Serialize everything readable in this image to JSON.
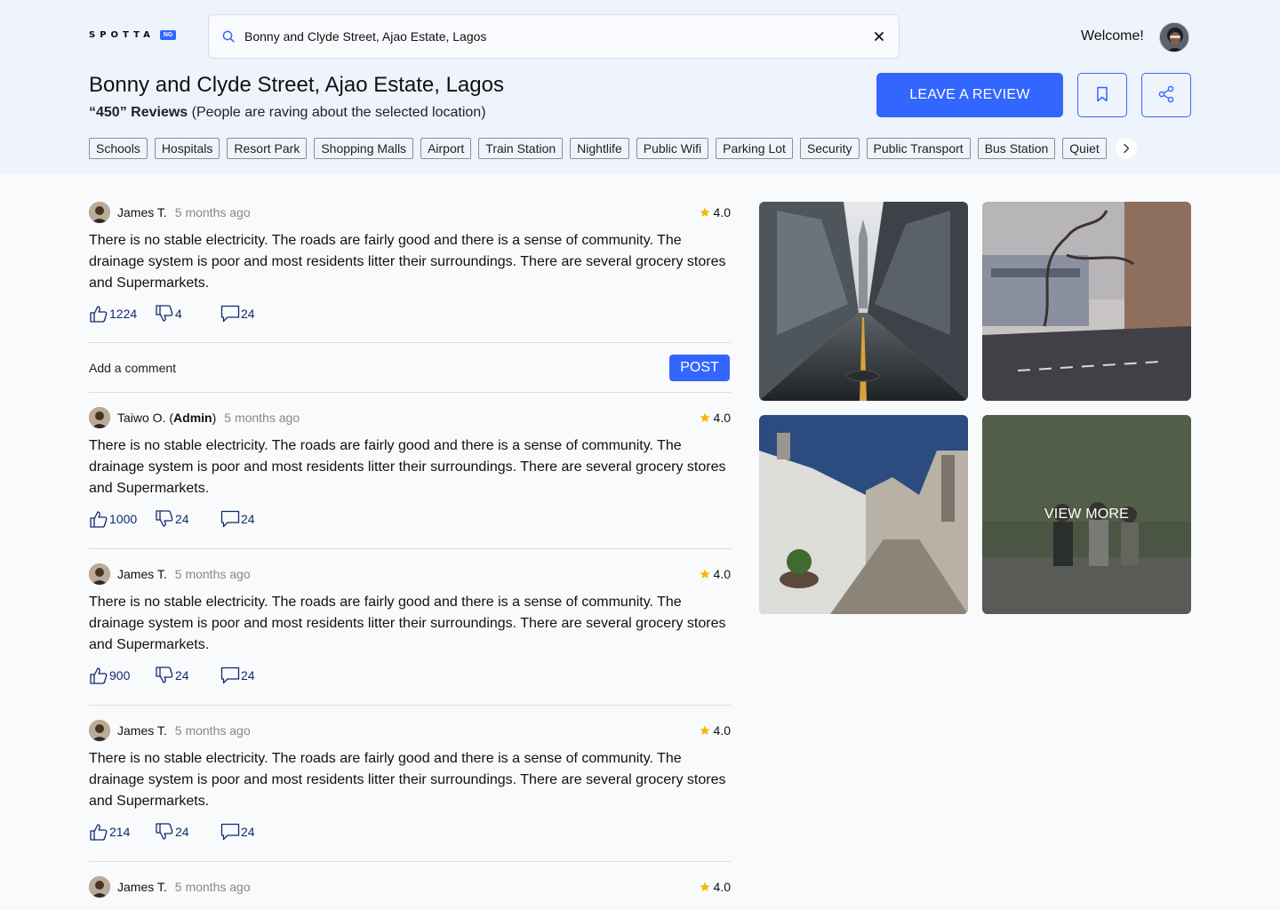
{
  "brand": {
    "name": "SPOTTA",
    "badge": "NG"
  },
  "search": {
    "value": "Bonny and Clyde Street, Ajao Estate, Lagos"
  },
  "user": {
    "welcome": "Welcome!"
  },
  "location": {
    "title": "Bonny and Clyde Street, Ajao Estate, Lagos",
    "review_count": "“450” Reviews",
    "review_note": "(People are raving about the selected location)"
  },
  "actions": {
    "leave_review": "LEAVE A REVIEW"
  },
  "tags": [
    "Schools",
    "Hospitals",
    "Resort Park",
    "Shopping Malls",
    "Airport",
    "Train Station",
    "Nightlife",
    "Public Wifi",
    "Parking Lot",
    "Security",
    "Public Transport",
    "Bus Station",
    "Quiet"
  ],
  "reviews": [
    {
      "name": "James T.",
      "role": "",
      "time": "5 months ago",
      "rating": "4.0",
      "text": "There is no stable electricity. The roads are fairly good and there is a sense of community. The drainage system is poor and most residents litter their surroundings. There are several grocery stores and Supermarkets.",
      "likes": "1224",
      "dislikes": "4",
      "comments": "24"
    },
    {
      "name": "Taiwo O.",
      "role": "Admin",
      "time": "5 months ago",
      "rating": "4.0",
      "text": "There is no stable electricity. The roads are fairly good and there is a sense of community. The drainage system is poor and most residents litter their surroundings. There are several grocery stores and Supermarkets.",
      "likes": "1000",
      "dislikes": "24",
      "comments": "24"
    },
    {
      "name": "James T.",
      "role": "",
      "time": "5 months ago",
      "rating": "4.0",
      "text": "There is no stable electricity. The roads are fairly good and there is a sense of community. The drainage system is poor and most residents litter their surroundings. There are several grocery stores and Supermarkets.",
      "likes": "900",
      "dislikes": "24",
      "comments": "24"
    },
    {
      "name": "James T.",
      "role": "",
      "time": "5 months ago",
      "rating": "4.0",
      "text": "There is no stable electricity. The roads are fairly good and there is a sense of community. The drainage system is poor and most residents litter their surroundings. There are several grocery stores and Supermarkets.",
      "likes": "214",
      "dislikes": "24",
      "comments": "24"
    },
    {
      "name": "James T.",
      "role": "",
      "time": "5 months ago",
      "rating": "4.0",
      "text": "",
      "likes": "",
      "dislikes": "",
      "comments": ""
    }
  ],
  "comment": {
    "label": "Add a comment",
    "post": "POST"
  },
  "gallery": {
    "view_more": "VIEW MORE"
  },
  "colors": {
    "accent": "#3366ff",
    "header_bg": "#eff3fb",
    "star": "#f5b700"
  }
}
